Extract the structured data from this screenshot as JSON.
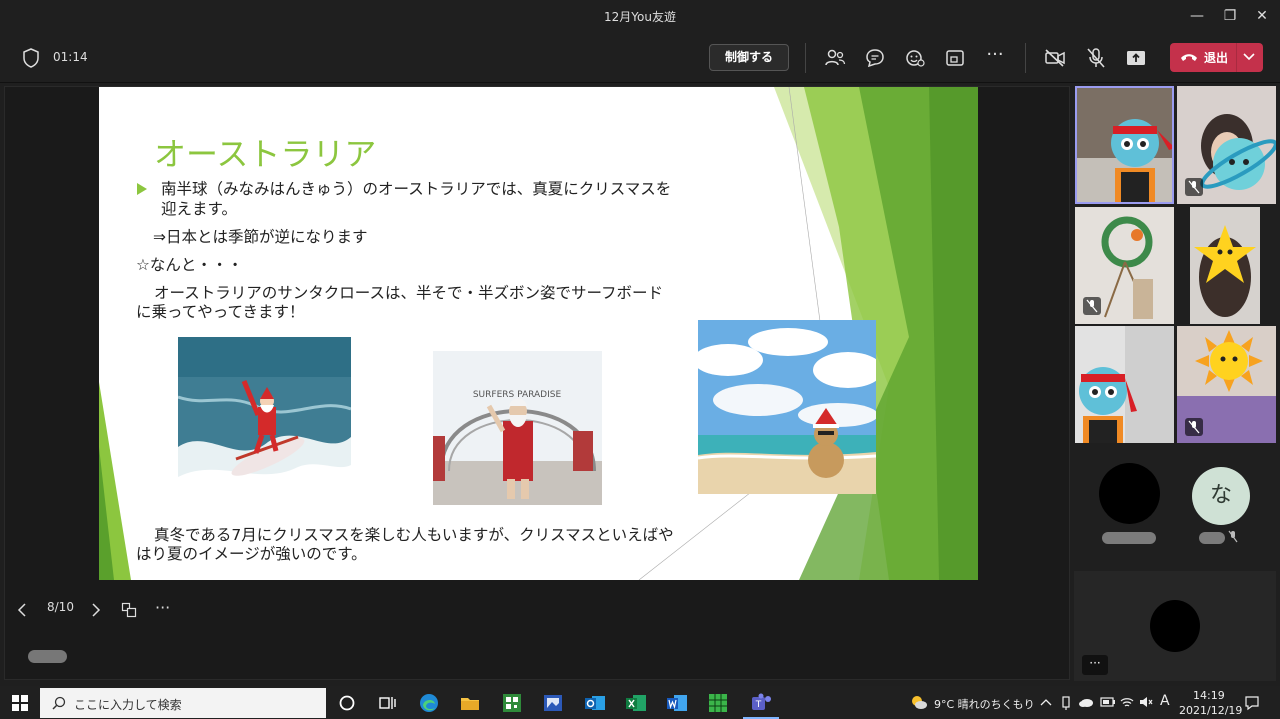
{
  "window": {
    "title": "12月You友遊"
  },
  "toolbar": {
    "elapsed_time": "01:14",
    "control_label": "制御する",
    "leave_label": "退出"
  },
  "slide": {
    "title": "オーストラリア",
    "bullet_line1": "南半球（みなみはんきゅう）のオーストラリアでは、真夏にクリスマスを",
    "bullet_line2": "迎えます。",
    "line_season": "⇒日本とは季節が逆になります",
    "line_nanto": "☆なんと・・・",
    "line_santa1": "オーストラリアのサンタクロースは、半そで・半ズボン姿でサーフボード",
    "line_santa2": "に乗ってやってきます！",
    "sign_text": "SURFERS PARADISE",
    "line_bottom1": "真冬である7月にクリスマスを楽しむ人もいますが、クリスマスといえばや",
    "line_bottom2": "はり夏のイメージが強いのです。"
  },
  "slide_nav": {
    "page": "8/10",
    "more": "···"
  },
  "participants": {
    "initial_avatar": "な",
    "more": "···"
  },
  "taskbar": {
    "search_placeholder": "ここに入力して検索",
    "weather": "9°C  晴れのちくもり",
    "time": "14:19",
    "date": "2021/12/19",
    "ime": "A"
  }
}
